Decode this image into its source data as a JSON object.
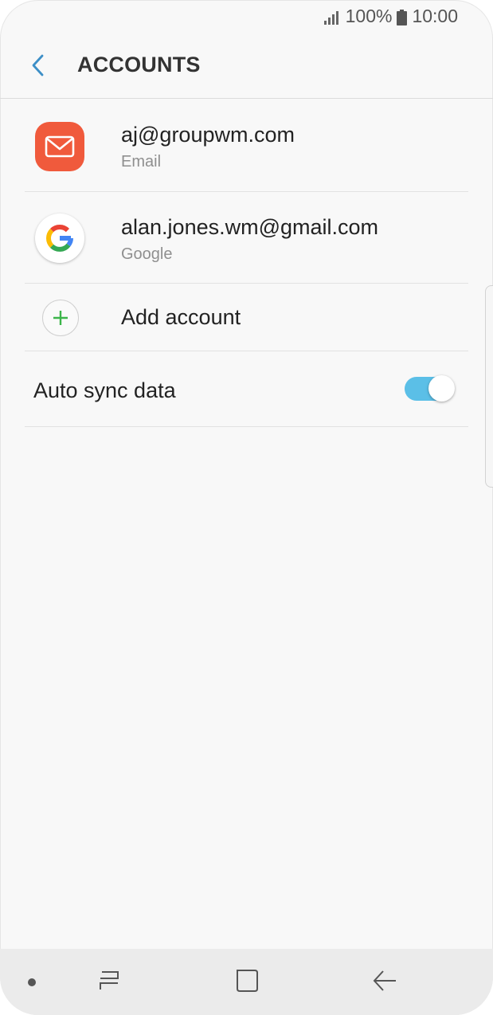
{
  "status_bar": {
    "battery_percent": "100%",
    "time": "10:00",
    "icons": [
      "signal-icon",
      "battery-icon"
    ]
  },
  "header": {
    "title": "ACCOUNTS",
    "back_icon": "chevron-left-icon"
  },
  "accounts": [
    {
      "primary": "aj@groupwm.com",
      "secondary": "Email",
      "icon": "email-app-icon"
    },
    {
      "primary": "alan.jones.wm@gmail.com",
      "secondary": "Google",
      "icon": "google-icon"
    }
  ],
  "add_account": {
    "label": "Add account",
    "icon": "plus-icon"
  },
  "auto_sync": {
    "label": "Auto sync data",
    "enabled": true
  },
  "nav_bar": {
    "buttons": [
      "recent-apps-icon",
      "home-icon",
      "back-icon"
    ]
  },
  "colors": {
    "accent": "#5bbfe7",
    "email_icon": "#f05a3c",
    "add_plus": "#3cb54a",
    "back_chevron": "#3d8fc7"
  }
}
